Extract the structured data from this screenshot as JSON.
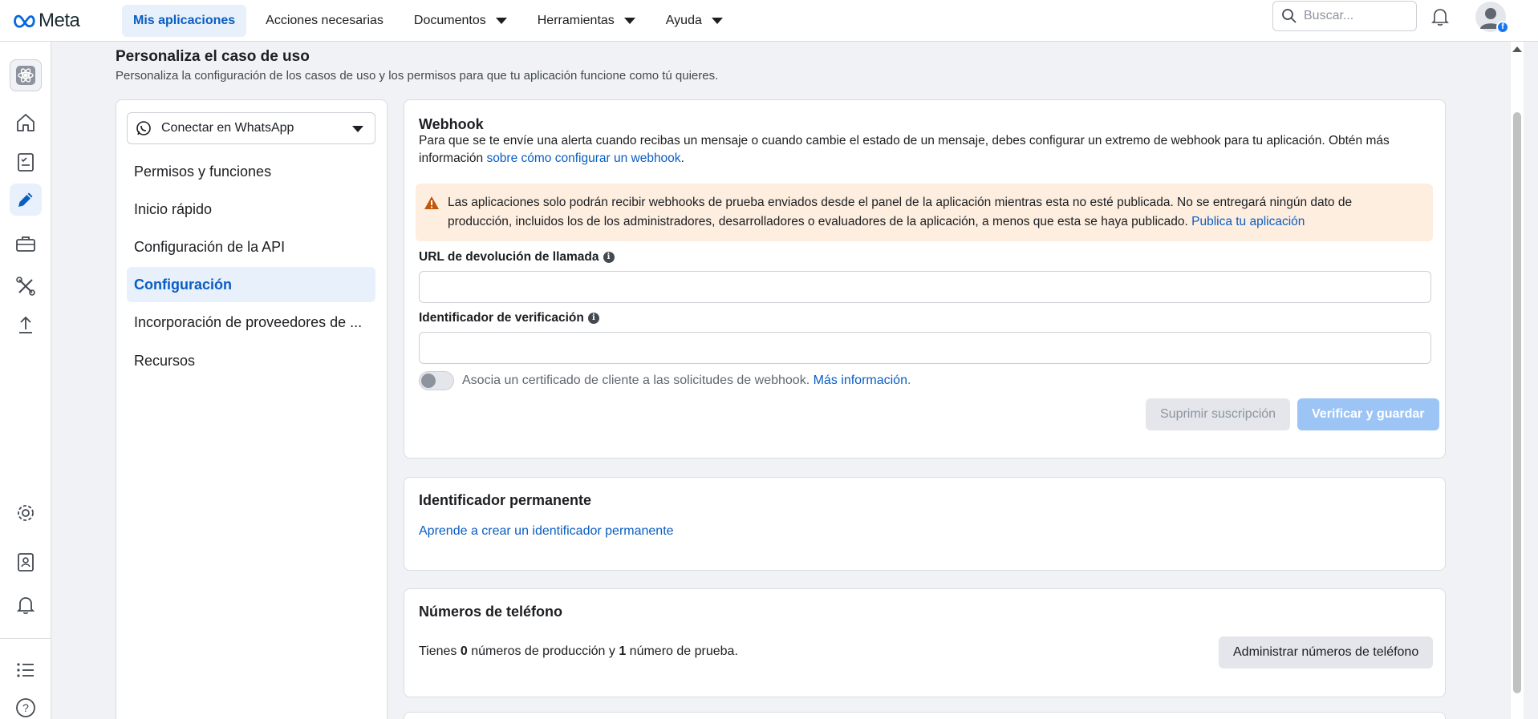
{
  "topbar": {
    "logo_text": "Meta",
    "nav": [
      {
        "label": "Mis aplicaciones",
        "active": true
      },
      {
        "label": "Acciones necesarias"
      },
      {
        "label": "Documentos",
        "dropdown": true
      },
      {
        "label": "Herramientas",
        "dropdown": true
      },
      {
        "label": "Ayuda",
        "dropdown": true
      }
    ],
    "search_placeholder": "Buscar...",
    "avatar_badge": "f"
  },
  "rail": {
    "icons": [
      "app-icon",
      "home-icon",
      "checklist-icon",
      "pencil-icon",
      "briefcase-icon",
      "tools-icon",
      "upload-icon",
      "gear-icon",
      "contacts-icon",
      "bell-icon",
      "list-icon",
      "help-icon"
    ],
    "active": "pencil-icon",
    "help_glyph": "?"
  },
  "page": {
    "title": "Personaliza el caso de uso",
    "subtitle": "Personaliza la configuración de los casos de uso y los permisos para que tu aplicación funcione como tú quieres."
  },
  "sidebar": {
    "use_case": "Conectar en WhatsApp",
    "items": [
      {
        "label": "Permisos y funciones"
      },
      {
        "label": "Inicio rápido"
      },
      {
        "label": "Configuración de la API"
      },
      {
        "label": "Configuración",
        "active": true
      },
      {
        "label": "Incorporación de proveedores de ..."
      },
      {
        "label": "Recursos"
      }
    ]
  },
  "webhook": {
    "title": "Webhook",
    "desc": "Para que se te envíe una alerta cuando recibas un mensaje o cuando cambie el estado de un mensaje, debes configurar un extremo de webhook para tu aplicación. Obtén más información ",
    "desc_link": "sobre cómo configurar un webhook",
    "desc_end": ".",
    "warning": "Las aplicaciones solo podrán recibir webhooks de prueba enviados desde el panel de la aplicación mientras esta no esté publicada. No se entregará ningún dato de producción, incluidos los de los administradores, desarrolladores o evaluadores de la aplicación, a menos que esta se haya publicado. ",
    "warning_link": "Publica tu aplicación",
    "callback_label": "URL de devolución de llamada",
    "callback_value": "",
    "verify_label": "Identificador de verificación",
    "verify_value": "",
    "info_glyph": "i",
    "toggle_text": "Asocia un certificado de cliente a las solicitudes de webhook. ",
    "toggle_link": "Más información",
    "toggle_end": ".",
    "toggle_on": false,
    "remove_btn": "Suprimir suscripción",
    "save_btn": "Verificar y guardar"
  },
  "permanent": {
    "title": "Identificador permanente",
    "link": "Aprende a crear un identificador permanente"
  },
  "phones": {
    "title": "Números de teléfono",
    "text_a": "Tienes ",
    "prod_count": "0",
    "text_b": " números de producción y ",
    "test_count": "1",
    "text_c": " número de prueba.",
    "manage_btn": "Administrar números de teléfono"
  },
  "colors": {
    "accent": "#0a5dc2",
    "active_bg": "#e7f0fb",
    "warning_bg": "#fdeee0",
    "warning_icon": "#c2570b",
    "primary_disabled": "#9cc4f5"
  }
}
